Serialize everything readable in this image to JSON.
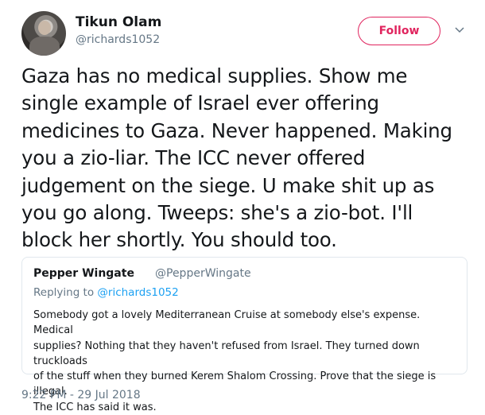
{
  "author": {
    "name": "Tikun Olam",
    "handle": "@richards1052"
  },
  "follow_label": "Follow",
  "tweet_text": "Gaza has no medical supplies. Show me\nsingle example of Israel ever offering\nmedicines to Gaza. Never happened. Making\nyou a zio-liar.  The ICC never offered\njudgement on the siege. U make shit up as\nyou go along. Tweeps: she's a zio-bot. I'll\nblock her shortly. You should too.",
  "quoted": {
    "name": "Pepper Wingate",
    "handle": "@PepperWingate",
    "reply_prefix": "Replying to",
    "reply_to": "@richards1052",
    "text": "Somebody got a lovely Mediterranean Cruise at somebody else's expense. Medical\nsupplies? Nothing that they haven't refused from Israel. They turned down truckloads\nof the stuff when they burned Kerem Shalom Crossing. Prove that the siege is illegal.\nThe ICC has said it was."
  },
  "timestamp": "9:22 PM - 29 Jul 2018",
  "colors": {
    "follow_accent": "#e0245e",
    "link": "#1da1f2",
    "secondary_text": "#657786"
  }
}
